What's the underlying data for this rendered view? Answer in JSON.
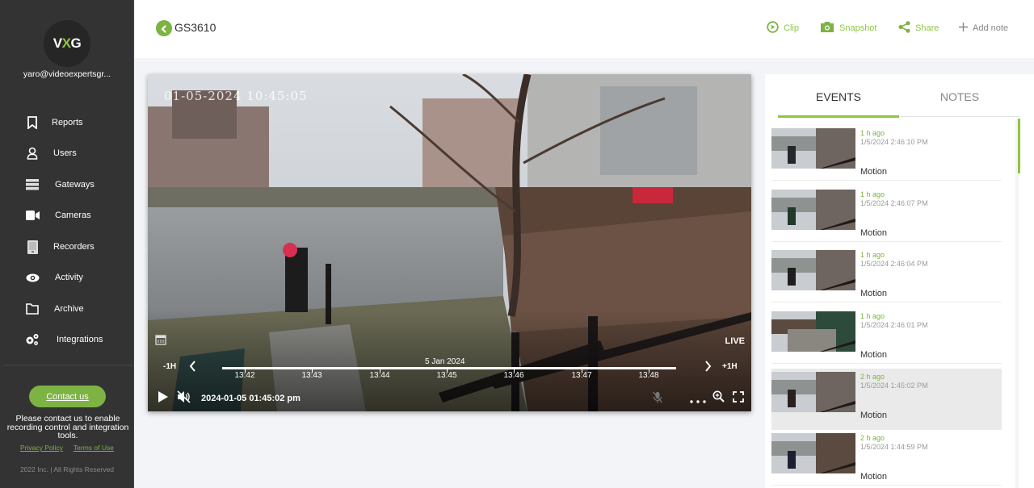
{
  "sidebar": {
    "logo": {
      "prefix": "V",
      "accent": "X",
      "suffix": "G"
    },
    "user_email": "yaro@videoexpertsgr...",
    "items": [
      {
        "label": "Reports",
        "icon": "bookmark-icon"
      },
      {
        "label": "Users",
        "icon": "user-icon"
      },
      {
        "label": "Gateways",
        "icon": "server-icon"
      },
      {
        "label": "Cameras",
        "icon": "video-camera-icon"
      },
      {
        "label": "Recorders",
        "icon": "recorder-icon"
      },
      {
        "label": "Activity",
        "icon": "eye-icon"
      },
      {
        "label": "Archive",
        "icon": "folder-icon"
      },
      {
        "label": "Integrations",
        "icon": "gears-icon"
      }
    ],
    "contact_button": "Contact us",
    "contact_note": "Please contact us to enable recording control and integration tools.",
    "privacy_policy": "Privacy Policy",
    "terms_of_use": "Terms of Use",
    "copyright": "2022 Inc. | All Rights Reserved"
  },
  "header": {
    "camera_name": "GS3610",
    "actions": {
      "clip": "Clip",
      "snapshot": "Snapshot",
      "share": "Share",
      "add_note": "Add note"
    }
  },
  "player": {
    "osd_timestamp": "01-05-2024 10:45:05",
    "live_label": "LIVE",
    "minus_hour": "-1H",
    "plus_hour": "+1H",
    "timeline_date": "5 Jan 2024",
    "timeline_ticks": [
      "13:42",
      "13:43",
      "13:44",
      "13:45",
      "13:46",
      "13:47",
      "13:48"
    ],
    "current_time": "2024-01-05 01:45:02 pm",
    "muted": true
  },
  "events_panel": {
    "tabs": [
      {
        "label": "EVENTS",
        "active": true
      },
      {
        "label": "NOTES",
        "active": false
      }
    ],
    "events": [
      {
        "ago": "1 h ago",
        "timestamp": "1/5/2024 2:46:10 PM",
        "type": "Motion",
        "selected": false
      },
      {
        "ago": "1 h ago",
        "timestamp": "1/5/2024 2:46:07 PM",
        "type": "Motion",
        "selected": false
      },
      {
        "ago": "1 h ago",
        "timestamp": "1/5/2024 2:46:04 PM",
        "type": "Motion",
        "selected": false
      },
      {
        "ago": "1 h ago",
        "timestamp": "1/5/2024 2:46:01 PM",
        "type": "Motion",
        "selected": false
      },
      {
        "ago": "2 h ago",
        "timestamp": "1/5/2024 1:45:02 PM",
        "type": "Motion",
        "selected": true
      },
      {
        "ago": "2 h ago",
        "timestamp": "1/5/2024 1:44:59 PM",
        "type": "Motion",
        "selected": false
      }
    ]
  },
  "colors": {
    "accent": "#8dc63f",
    "accent_dark": "#7cb342",
    "sidebar_bg": "#333333",
    "page_bg": "#f3f4f7"
  }
}
